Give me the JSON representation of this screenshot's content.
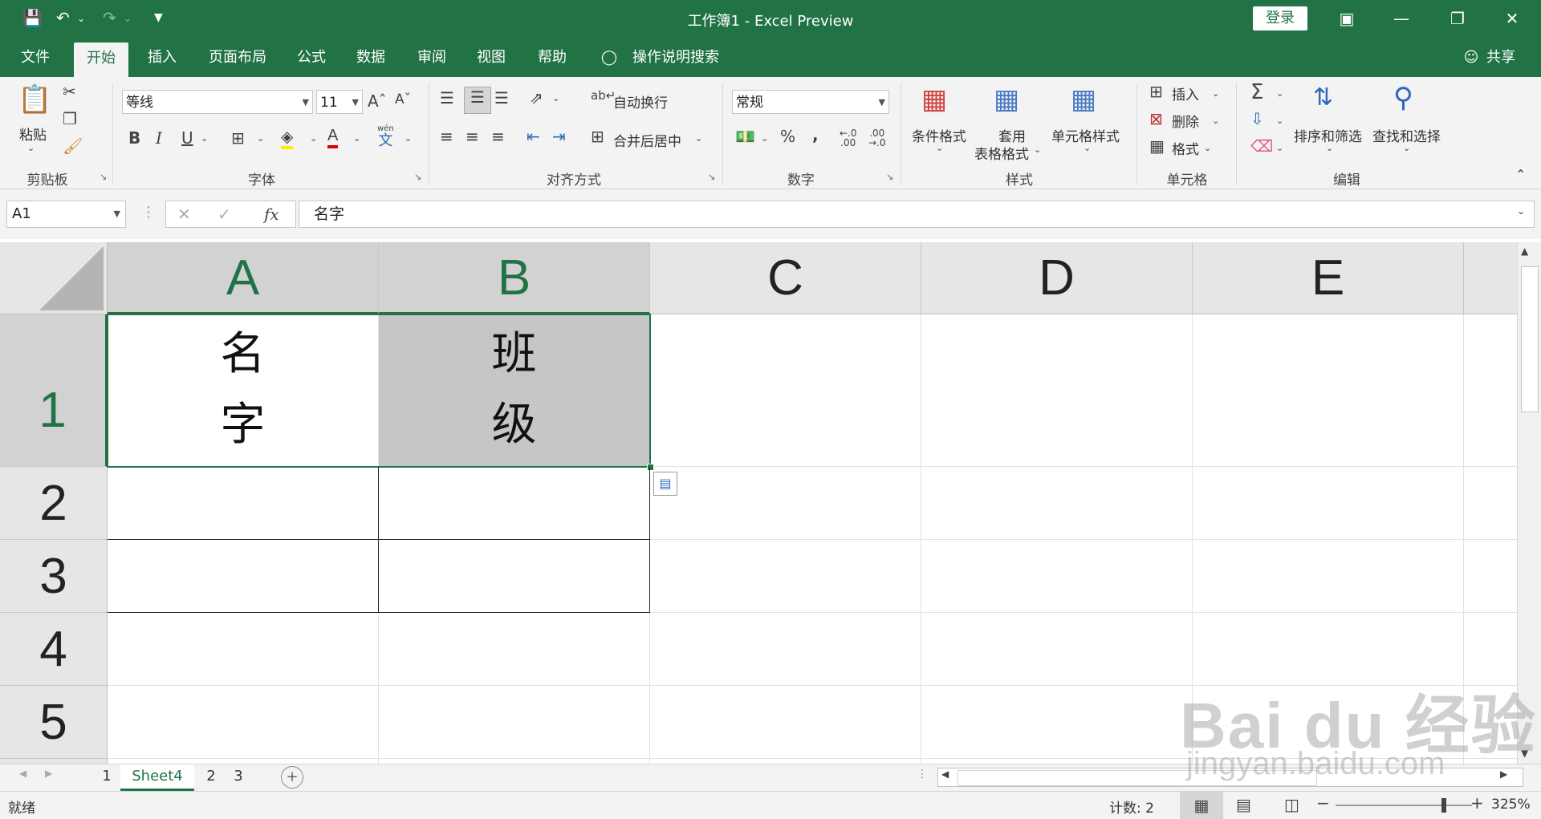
{
  "window": {
    "title": "工作簿1 - Excel Preview",
    "login": "登录"
  },
  "tabs": [
    "文件",
    "开始",
    "插入",
    "页面布局",
    "公式",
    "数据",
    "审阅",
    "视图",
    "帮助"
  ],
  "tell_me": "操作说明搜索",
  "share": "共享",
  "ribbon": {
    "clipboard": {
      "paste": "粘贴",
      "label": "剪贴板"
    },
    "font": {
      "name": "等线",
      "size": "11",
      "label": "字体",
      "bold": "B",
      "italic": "I",
      "underline": "U",
      "font_color_glyph": "A",
      "wen_glyph": "wén",
      "wen_char": "文"
    },
    "alignment": {
      "wrap": "自动换行",
      "merge": "合并后居中",
      "label": "对齐方式"
    },
    "number": {
      "format": "常规",
      "percent": "%",
      "comma": ",",
      "label": "数字"
    },
    "styles": {
      "conditional": "条件格式",
      "table_line1": "套用",
      "table_line2": "表格格式",
      "cell_styles": "单元格样式",
      "label": "样式"
    },
    "cells": {
      "insert": "插入",
      "delete": "删除",
      "format": "格式",
      "label": "单元格"
    },
    "editing": {
      "sort": "排序和筛选",
      "find": "查找和选择",
      "label": "编辑"
    }
  },
  "formula_bar": {
    "name_box": "A1",
    "formula": "名字",
    "fx": "fx"
  },
  "grid": {
    "columns": [
      "A",
      "B",
      "C",
      "D",
      "E"
    ],
    "rows": [
      "1",
      "2",
      "3",
      "4",
      "5"
    ],
    "cells": {
      "A1": "名字",
      "B1": "班级"
    }
  },
  "sheets": [
    "1",
    "Sheet4",
    "2",
    "3"
  ],
  "status": {
    "ready": "就绪",
    "count": "计数: 2",
    "zoom": "325%"
  },
  "watermark": {
    "brand": "Bai du 经验",
    "url": "jingyan.baidu.com"
  }
}
